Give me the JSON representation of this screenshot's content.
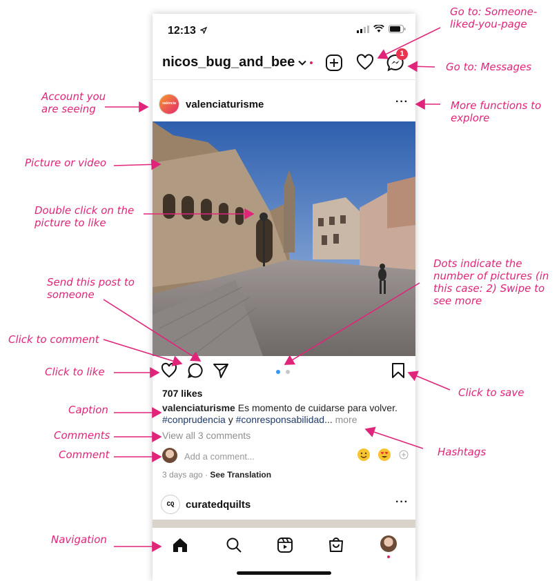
{
  "status_bar": {
    "time": "12:13"
  },
  "header": {
    "username": "nicos_bug_and_bee",
    "messages_badge": "1"
  },
  "post": {
    "username": "valenciaturisme",
    "avatar_text": "valència",
    "likes": "707 likes",
    "caption_user": "valenciaturisme",
    "caption_text": " Es momento de cuidarse para volver. ",
    "hashtag_1": "#conprudencia",
    "caption_join": " y ",
    "hashtag_2": "#conresponsabilidad",
    "ellipsis": "...",
    "more": " more",
    "view_comments": "View all 3 comments",
    "add_comment_placeholder": "Add a comment...",
    "time_ago": "3 days ago",
    "separator": " · ",
    "see_translation": "See Translation",
    "carousel": {
      "pages": 2,
      "current": 1
    }
  },
  "next_post": {
    "username": "curatedquilts",
    "avatar_text": "CQ"
  },
  "annotations": {
    "liked": "Go to: Someone-liked-you-page",
    "messages": "Go to: Messages",
    "account": "Account you are seeing",
    "more_functions": "More functions to explore",
    "picture": "Picture or video",
    "double_click": "Double click on the picture to like",
    "dots": "Dots indicate the number of pictures (in this case: 2) Swipe to see more",
    "send": "Send this post to someone",
    "comment_click": "Click to comment",
    "like_click": "Click to like",
    "save": "Click to save",
    "caption": "Caption",
    "comments": "Comments",
    "comment": "Comment",
    "hashtags": "Hashtags",
    "navigation": "Navigation"
  },
  "colors": {
    "annotation": "#e0247a",
    "badge": "#e8344e",
    "carousel_active": "#3897f0",
    "hashtag": "#1f3a6b"
  }
}
